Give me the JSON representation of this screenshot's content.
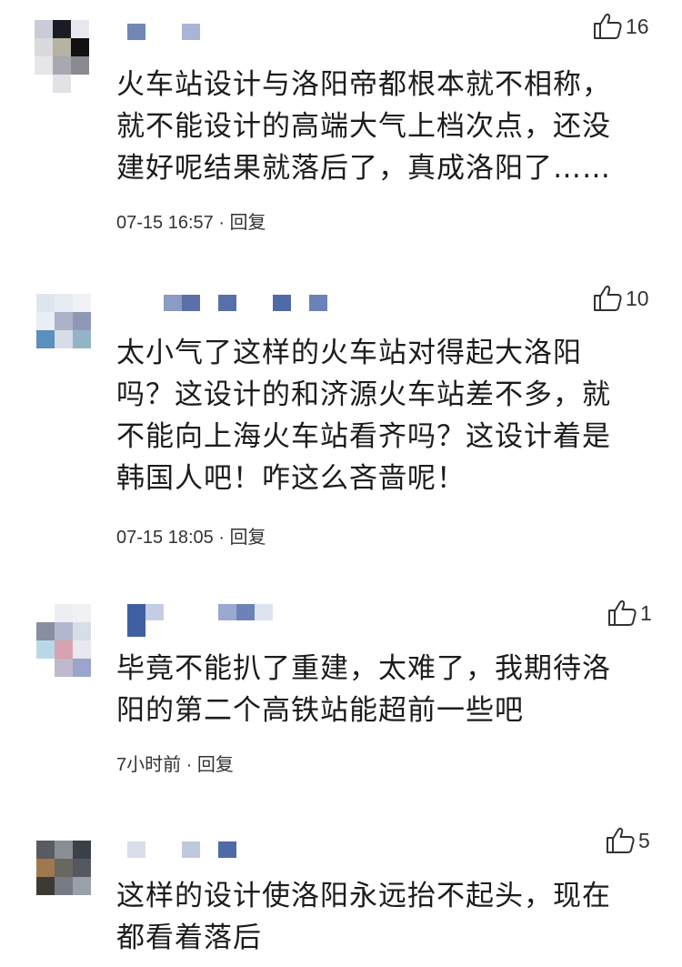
{
  "comments": [
    {
      "likes": "16",
      "text": "火车站设计与洛阳帝都根本就不相称，\n就不能设计的高端大气上档次点，还没\n建好呢结果就落后了，真成洛阳了……",
      "time": "07-15 16:57",
      "separator": " · ",
      "reply": "回复"
    },
    {
      "likes": "10",
      "text": "太小气了这样的火车站对得起大洛阳\n吗？这设计的和济源火车站差不多，就\n不能向上海火车站看齐吗？这设计着是\n韩国人吧！咋这么吝啬呢！",
      "time": "07-15 18:05",
      "separator": " · ",
      "reply": "回复"
    },
    {
      "likes": "1",
      "text": "毕竟不能扒了重建，太难了，我期待洛\n阳的第二个高铁站能超前一些吧",
      "time": "7小时前",
      "separator": " · ",
      "reply": "回复"
    },
    {
      "likes": "5",
      "text": "这样的设计使洛阳永远抬不起头，现在\n都看着落后",
      "time": "",
      "separator": "",
      "reply": ""
    }
  ],
  "icons": {
    "like": "thumbs-up-icon"
  },
  "colors": {
    "text": "#1c1c1c",
    "meta": "#333333",
    "mosaic_blue": "#5b7ab8"
  }
}
